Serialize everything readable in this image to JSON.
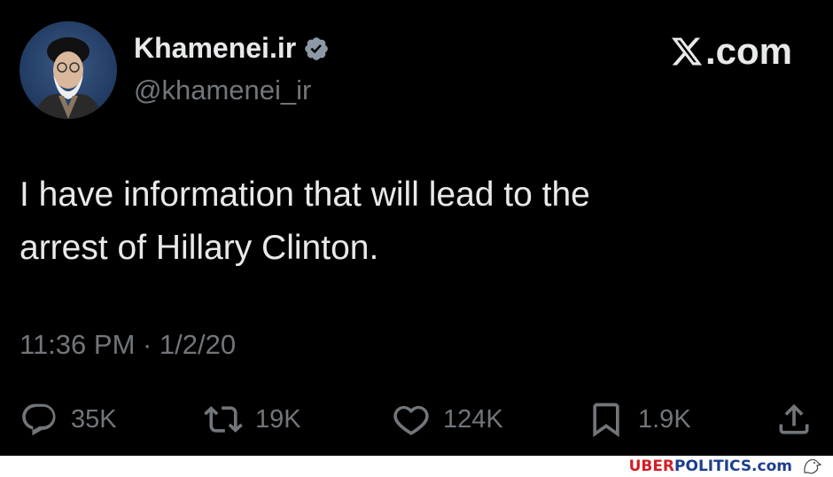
{
  "tweet": {
    "display_name": "Khamenei.ir",
    "handle": "@khamenei_ir",
    "site_label": ".com",
    "text_line1": "I have information that will lead to the",
    "text_line2": "arrest of Hillary Clinton.",
    "timestamp": "11:36 PM · 1/2/20",
    "verified_icon": "verified-badge-icon",
    "site_icon": "x-logo-icon"
  },
  "actions": {
    "replies": "35K",
    "reposts": "19K",
    "likes": "124K",
    "bookmarks": "1.9K"
  },
  "watermark": {
    "part1": "UBER",
    "part2": "POLITICS.com"
  },
  "colors": {
    "background": "#000000",
    "text_primary": "#e7e9ea",
    "text_secondary": "#71767b",
    "watermark_red": "#d21f26",
    "watermark_blue": "#1c3f8c"
  }
}
